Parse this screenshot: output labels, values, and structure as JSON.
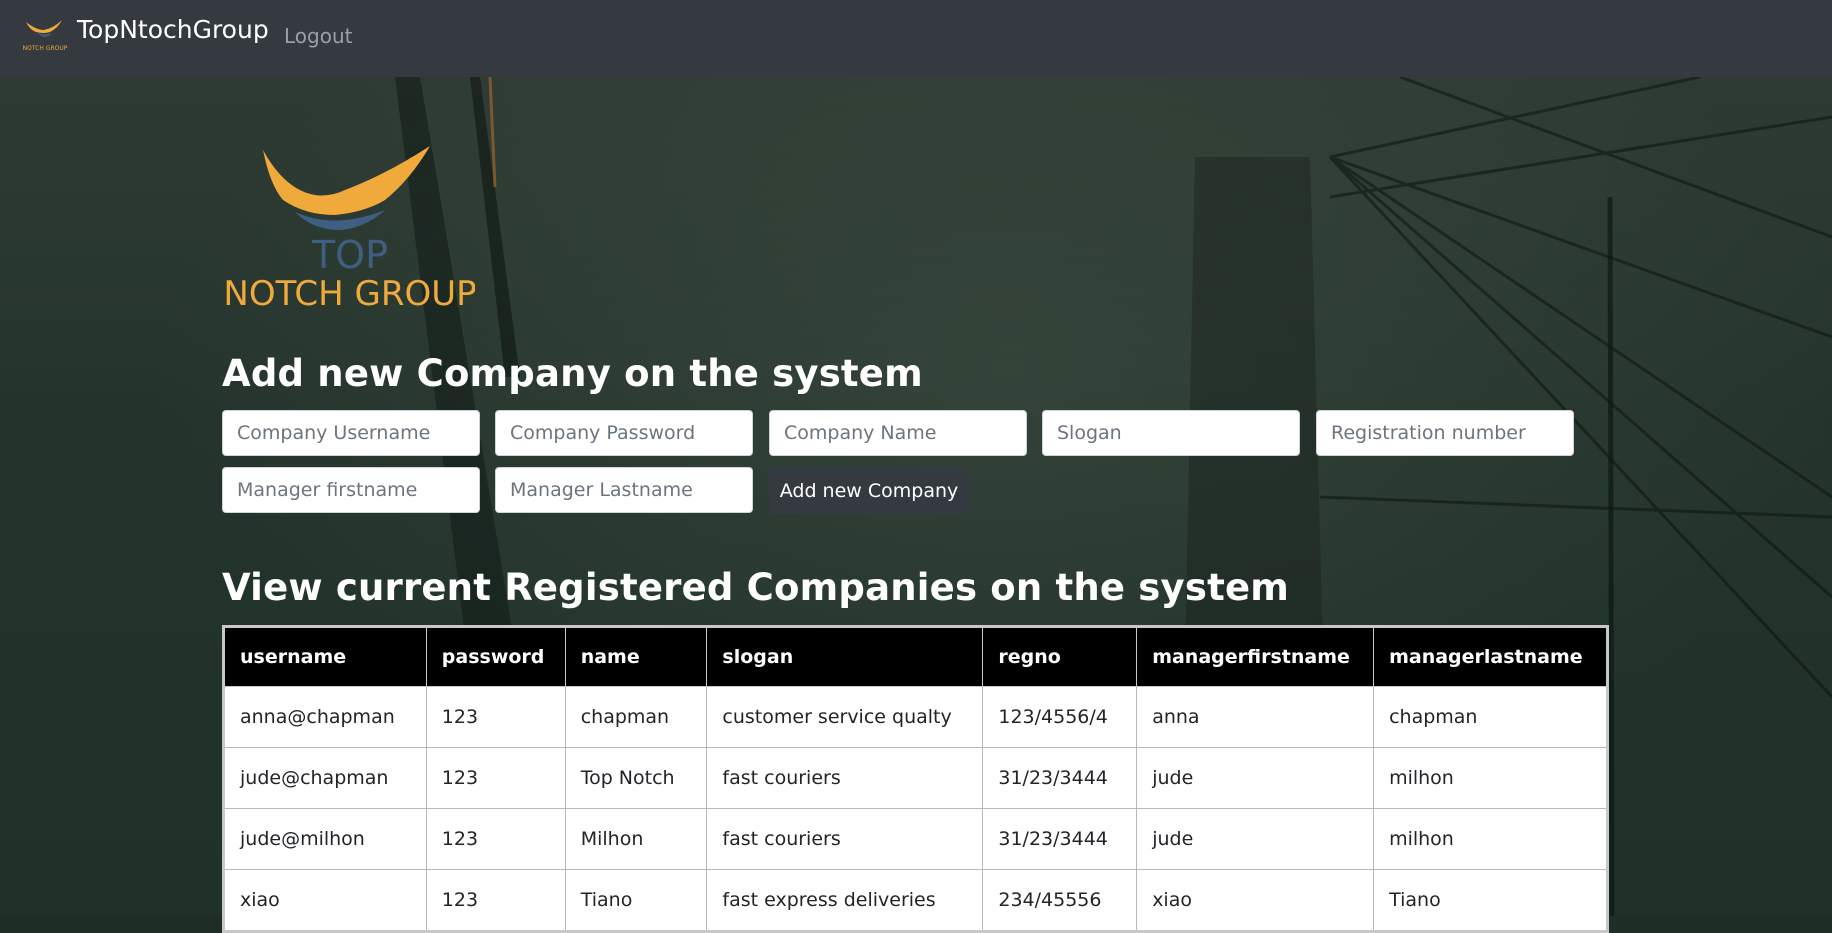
{
  "navbar": {
    "brand_name": "TopNtochGroup",
    "brand_logo_text": "NOTCH GROUP",
    "logout_label": "Logout"
  },
  "hero_logo": {
    "line1": "TOP",
    "line2": "NOTCH GROUP"
  },
  "add_section": {
    "heading": "Add new Company on the system",
    "fields": {
      "company_username": "Company Username",
      "company_password": "Company Password",
      "company_name": "Company Name",
      "slogan": "Slogan",
      "registration_number": "Registration number",
      "manager_firstname": "Manager firstname",
      "manager_lastname": "Manager Lastname"
    },
    "submit_label": "Add new Company"
  },
  "view_section": {
    "heading": "View current Registered Companies on the system",
    "columns": [
      "username",
      "password",
      "name",
      "slogan",
      "regno",
      "managerfirstname",
      "managerlastname"
    ],
    "rows": [
      [
        "anna@chapman",
        "123",
        "chapman",
        "customer service qualty",
        "123/4556/4",
        "anna",
        "chapman"
      ],
      [
        "jude@chapman",
        "123",
        "Top Notch",
        "fast couriers",
        "31/23/3444",
        "jude",
        "milhon"
      ],
      [
        "jude@milhon",
        "123",
        "Milhon",
        "fast couriers",
        "31/23/3444",
        "jude",
        "milhon"
      ],
      [
        "xiao",
        "123",
        "Tiano",
        "fast express deliveries",
        "234/45556",
        "xiao",
        "Tiano"
      ]
    ]
  },
  "colors": {
    "navbar": "#343a40",
    "accent_orange": "#f0a93b",
    "logo_blue": "#3f5f82",
    "table_header": "#000000"
  }
}
